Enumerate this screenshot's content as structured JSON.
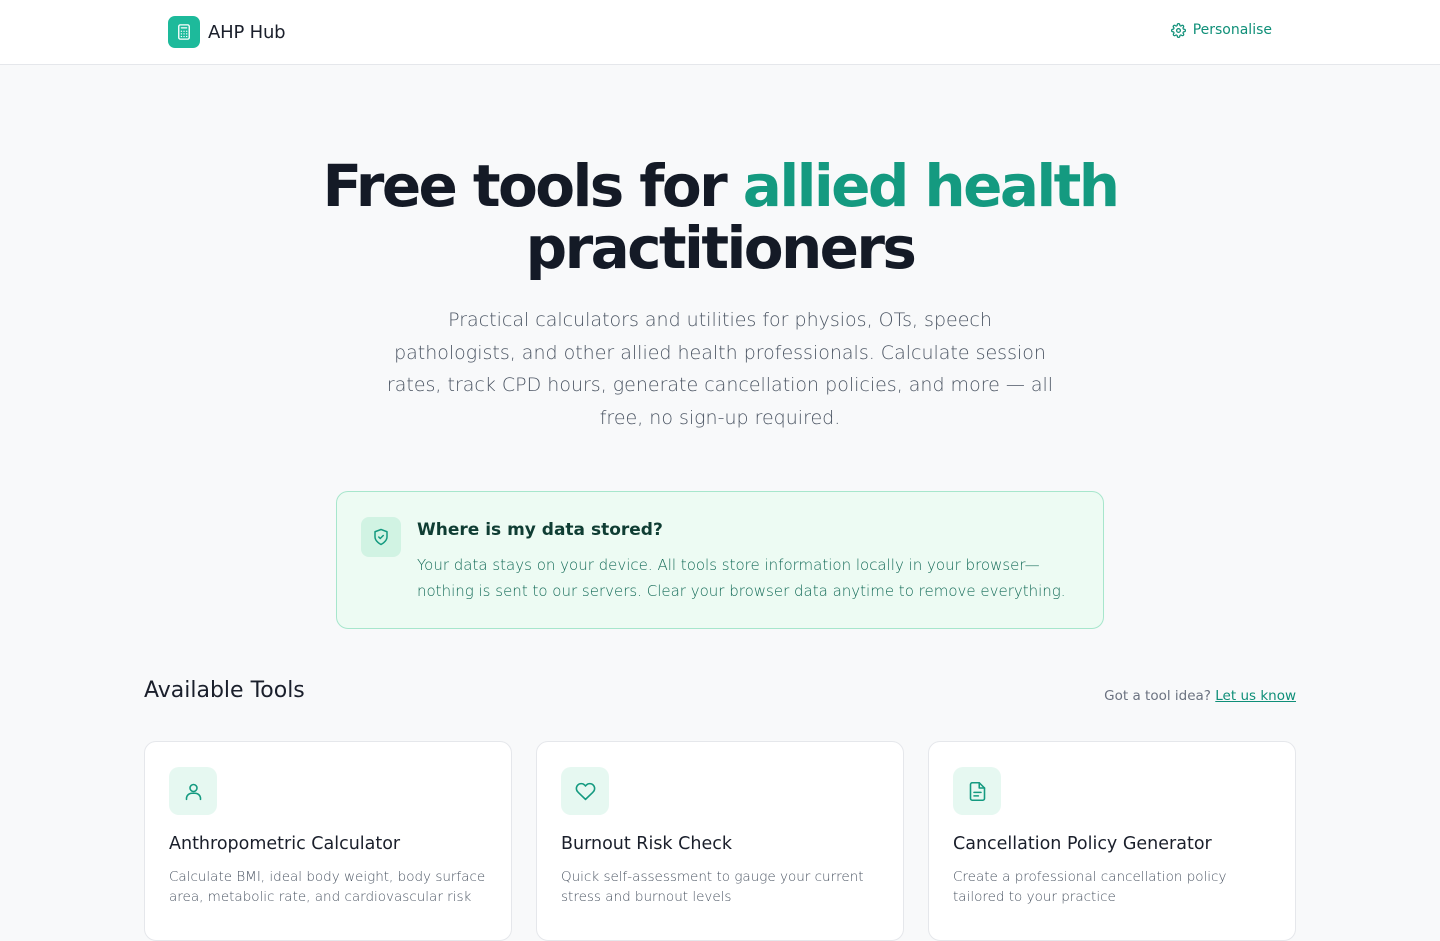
{
  "header": {
    "brand": "AHP Hub",
    "personalise_label": "Personalise"
  },
  "hero": {
    "title_part1": "Free tools for ",
    "title_accent": "allied health",
    "title_part2": "practitioners",
    "subtitle": "Practical calculators and utilities for physios, OTs, speech pathologists, and other allied health professionals. Calculate session rates, track CPD hours, generate cancellation policies, and more — all free, no sign-up required."
  },
  "notice": {
    "title": "Where is my data stored?",
    "text": "Your data stays on your device. All tools store information locally in your browser—nothing is sent to our servers. Clear your browser data anytime to remove everything."
  },
  "tools_section": {
    "title": "Available Tools",
    "idea_prompt": "Got a tool idea?",
    "idea_link": "Let us know"
  },
  "cards": [
    {
      "icon": "user-icon",
      "title": "Anthropometric Calculator",
      "description": "Calculate BMI, ideal body weight, body surface area, metabolic rate, and cardiovascular risk"
    },
    {
      "icon": "heart-icon",
      "title": "Burnout Risk Check",
      "description": "Quick self-assessment to gauge your current stress and burnout levels"
    },
    {
      "icon": "document-icon",
      "title": "Cancellation Policy Generator",
      "description": "Create a professional cancellation policy tailored to your practice"
    }
  ],
  "colors": {
    "accent": "#149a80",
    "brand": "#1dba9b",
    "notice_bg": "#edfbf3"
  }
}
